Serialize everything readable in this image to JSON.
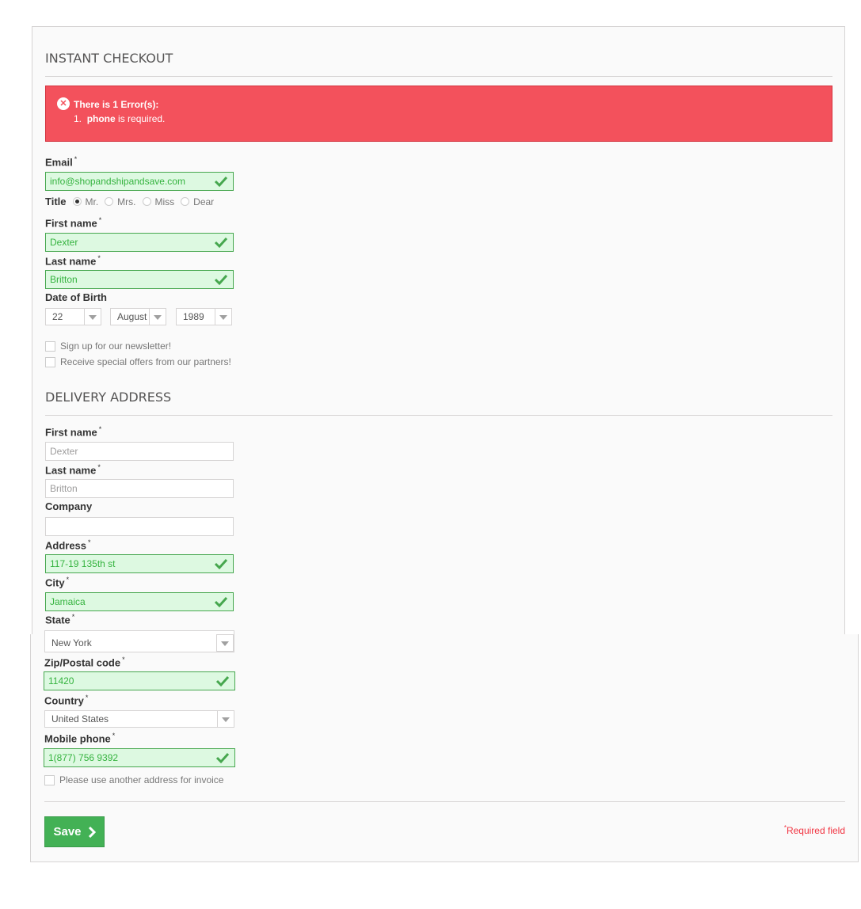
{
  "checkout": {
    "title": "INSTANT CHECKOUT",
    "error": {
      "heading": "There is 1 Error(s):",
      "number": "1.",
      "field": "phone",
      "message": " is required."
    },
    "email": {
      "label": "Email",
      "value": "info@shopandshipandsave.com"
    },
    "title_field": {
      "label": "Title",
      "options": [
        "Mr.",
        "Mrs.",
        "Miss",
        "Dear"
      ],
      "selected": "Mr."
    },
    "first_name": {
      "label": "First name",
      "value": "Dexter"
    },
    "last_name": {
      "label": "Last name",
      "value": "Britton"
    },
    "dob": {
      "label": "Date of Birth",
      "day": "22",
      "month": "August",
      "year": "1989"
    },
    "newsletter": {
      "label": "Sign up for our newsletter!",
      "checked": false
    },
    "offers": {
      "label": "Receive special offers from our partners!",
      "checked": false
    }
  },
  "delivery": {
    "title": "DELIVERY ADDRESS",
    "first_name": {
      "label": "First name",
      "placeholder": "Dexter"
    },
    "last_name": {
      "label": "Last name",
      "placeholder": "Britton"
    },
    "company": {
      "label": "Company",
      "value": ""
    },
    "address": {
      "label": "Address",
      "value": "117-19 135th st"
    },
    "city": {
      "label": "City",
      "value": "Jamaica"
    },
    "state": {
      "label": "State",
      "value": "New York"
    },
    "zip": {
      "label": "Zip/Postal code",
      "value": "11420"
    },
    "country": {
      "label": "Country",
      "value": "United States"
    },
    "mobile": {
      "label": "Mobile phone",
      "value": "1(877) 756 9392"
    },
    "invoice": {
      "label": "Please use another address for invoice",
      "checked": false
    }
  },
  "footer": {
    "save_label": "Save",
    "required_mark": "*",
    "required_note": "Required field"
  },
  "required_mark": "*",
  "colors": {
    "error_bg": "#f3515c",
    "valid_bg": "#ddf9e1",
    "valid_border": "#46a74e",
    "save_bg": "#43b155",
    "required": "#f13340"
  }
}
